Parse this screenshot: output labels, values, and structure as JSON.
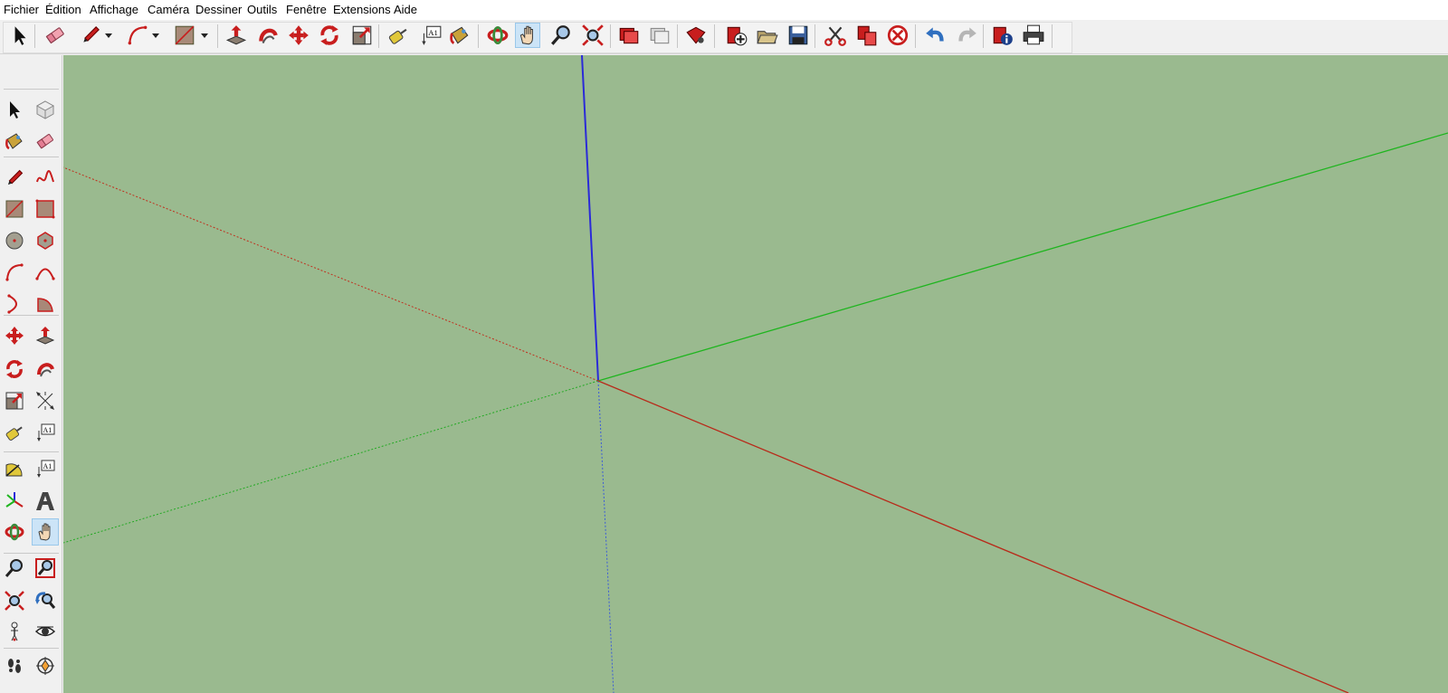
{
  "menu": [
    "Fichier",
    "Édition",
    "Affichage",
    "Caméra",
    "Dessiner",
    "Outils",
    "Fenêtre",
    "Extensions",
    "Aide"
  ],
  "toolbar": {
    "tools": [
      {
        "name": "select-icon"
      },
      {
        "name": "eraser-icon"
      },
      {
        "name": "pencil-icon"
      },
      {
        "name": "arc-icon"
      },
      {
        "name": "rectangle-icon"
      },
      {
        "name": "push-pull-icon"
      },
      {
        "name": "follow-me-icon"
      },
      {
        "name": "move-icon"
      },
      {
        "name": "rotate-icon"
      },
      {
        "name": "scale-icon"
      },
      {
        "name": "tape-measure-icon"
      },
      {
        "name": "text-icon",
        "label": "A1"
      },
      {
        "name": "paint-bucket-icon"
      },
      {
        "name": "orbit-icon"
      },
      {
        "name": "pan-icon",
        "active": true
      },
      {
        "name": "zoom-icon"
      },
      {
        "name": "zoom-extents-icon"
      },
      {
        "name": "warehouse-icon"
      },
      {
        "name": "share-model-icon"
      },
      {
        "name": "extension-warehouse-icon"
      },
      {
        "name": "new-file-icon"
      },
      {
        "name": "open-file-icon"
      },
      {
        "name": "save-icon"
      },
      {
        "name": "cut-icon"
      },
      {
        "name": "copy-icon"
      },
      {
        "name": "delete-icon"
      },
      {
        "name": "undo-icon"
      },
      {
        "name": "redo-icon"
      },
      {
        "name": "model-info-icon"
      },
      {
        "name": "print-icon"
      }
    ]
  },
  "sidebar": {
    "tools": [
      "select-icon",
      "component-icon",
      "paint-bucket-icon",
      "eraser-icon",
      "line-icon",
      "freehand-icon",
      "rectangle-icon",
      "rotated-rectangle-icon",
      "circle-icon",
      "polygon-icon",
      "arc-icon",
      "two-point-arc-icon",
      "three-point-arc-icon",
      "pie-icon",
      "move-icon",
      "push-pull-icon",
      "rotate-icon",
      "follow-me-icon",
      "scale-icon",
      "offset-icon",
      "tape-measure-icon",
      "dimension-icon",
      "protractor-icon",
      "text-icon",
      "axes-icon",
      "3d-text-icon",
      "orbit-icon",
      "pan-icon",
      "zoom-icon",
      "zoom-window-icon",
      "zoom-extents-icon",
      "previous-view-icon",
      "position-camera-icon",
      "look-around-icon",
      "walk-icon",
      "section-plane-icon"
    ],
    "text_label": "A1",
    "active": "pan-icon"
  },
  "colors": {
    "viewport_bg": "#9aba8f",
    "red_axis": "#c0301e",
    "green_axis": "#1fb51f",
    "blue_axis": "#2a2ad8",
    "toolbar_red": "#c81e1e"
  }
}
